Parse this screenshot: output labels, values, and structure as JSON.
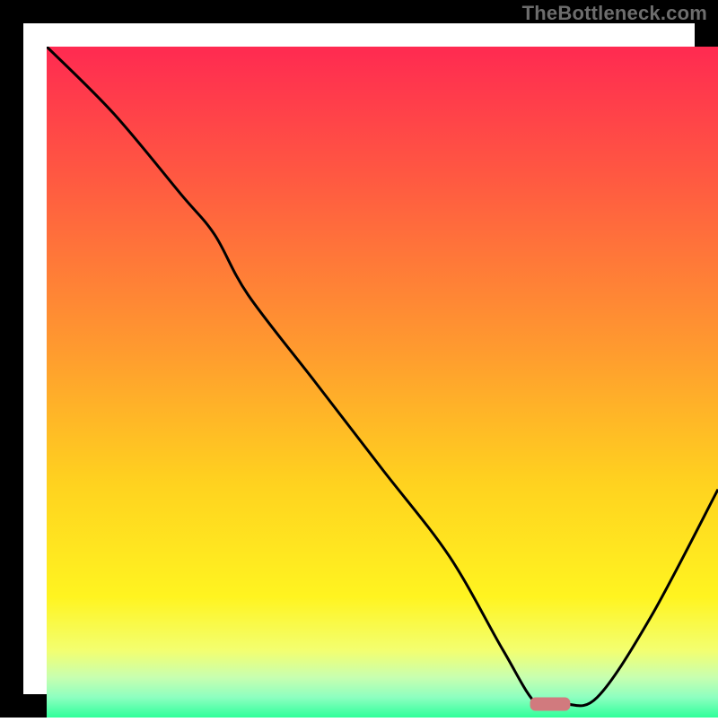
{
  "watermark": "TheBottleneck.com",
  "chart_data": {
    "type": "line",
    "title": "",
    "xlabel": "",
    "ylabel": "",
    "xlim": [
      0,
      100
    ],
    "ylim": [
      0,
      100
    ],
    "grid": false,
    "legend": false,
    "series": [
      {
        "name": "bottleneck-curve",
        "color": "#000000",
        "x": [
          0,
          10,
          20,
          25,
          30,
          40,
          50,
          60,
          68,
          73,
          77,
          82,
          90,
          100
        ],
        "y": [
          100,
          90,
          78,
          72,
          63,
          50,
          37,
          24,
          10,
          2,
          2,
          3,
          15,
          34
        ]
      }
    ],
    "marker": {
      "name": "optimal-range",
      "color": "#d17a7e",
      "x": 75,
      "y": 2,
      "width": 6,
      "height": 2
    },
    "background_gradient": {
      "stops": [
        {
          "offset": 0.0,
          "color": "#ff2a51"
        },
        {
          "offset": 0.2,
          "color": "#ff5a41"
        },
        {
          "offset": 0.45,
          "color": "#ff9a2f"
        },
        {
          "offset": 0.65,
          "color": "#ffd21f"
        },
        {
          "offset": 0.82,
          "color": "#fff420"
        },
        {
          "offset": 0.9,
          "color": "#f3ff70"
        },
        {
          "offset": 0.94,
          "color": "#c8ffb0"
        },
        {
          "offset": 0.97,
          "color": "#8dffc0"
        },
        {
          "offset": 1.0,
          "color": "#2fff9a"
        }
      ]
    }
  }
}
